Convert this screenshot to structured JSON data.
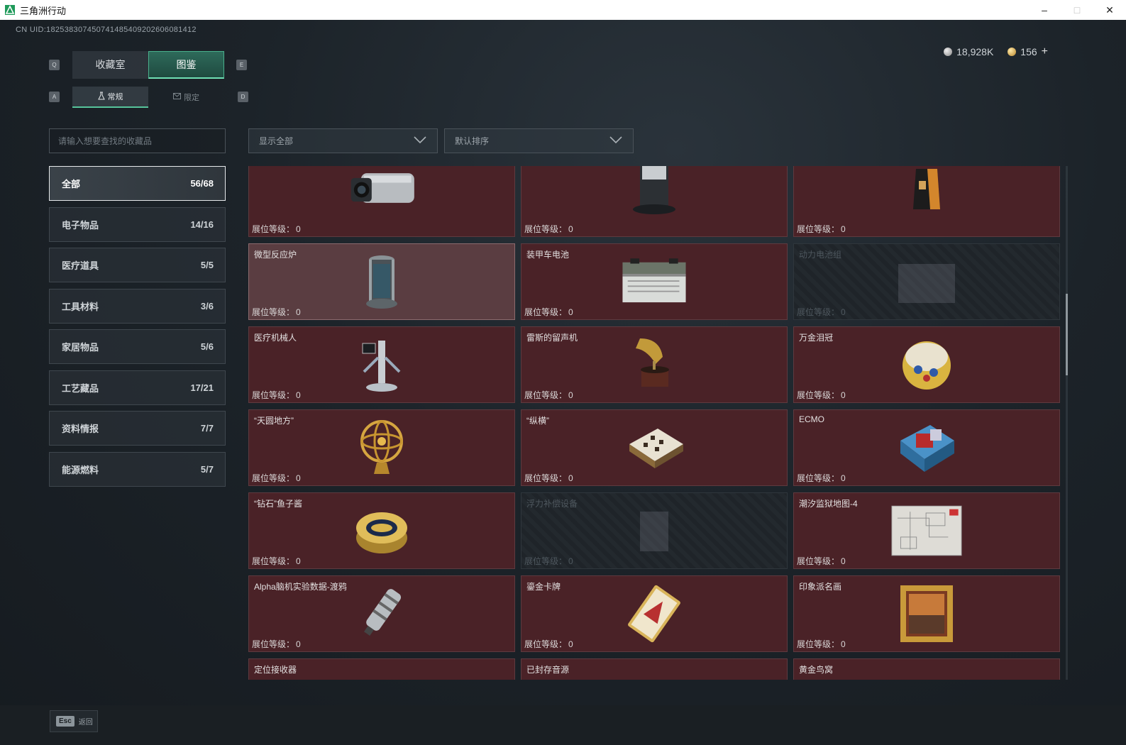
{
  "window": {
    "title": "三角洲行动"
  },
  "uid": "CN UID:18253830745074148540920260608141​2",
  "currency": {
    "silver": "18,928K",
    "gold": "156",
    "plus": "+"
  },
  "keys": {
    "q": "Q",
    "e": "E",
    "a": "A",
    "d": "D"
  },
  "tabs": [
    {
      "label": "收藏室"
    },
    {
      "label": "图鉴"
    }
  ],
  "subtabs": [
    {
      "label": "常规"
    },
    {
      "label": "限定"
    }
  ],
  "search": {
    "placeholder": "请输入想要查找的收藏品",
    "value": ""
  },
  "filters": {
    "display": "显示全部",
    "sort": "默认排序"
  },
  "categories": [
    {
      "label": "全部",
      "count": "56/68"
    },
    {
      "label": "电子物品",
      "count": "14/16"
    },
    {
      "label": "医疗道具",
      "count": "5/5"
    },
    {
      "label": "工具材料",
      "count": "3/6"
    },
    {
      "label": "家居物品",
      "count": "5/6"
    },
    {
      "label": "工艺藏品",
      "count": "17/21"
    },
    {
      "label": "资料情报",
      "count": "7/7"
    },
    {
      "label": "能源燃料",
      "count": "5/7"
    }
  ],
  "level_label": "展位等级：",
  "items": [
    {
      "name": "",
      "level": "0",
      "icon": "camera-icon"
    },
    {
      "name": "",
      "level": "0",
      "icon": "robot-vacuum-icon"
    },
    {
      "name": "",
      "level": "0",
      "icon": "coffee-bag-icon"
    },
    {
      "name": "微型反应炉",
      "level": "0",
      "icon": "reactor-icon"
    },
    {
      "name": "装甲车电池",
      "level": "0",
      "icon": "battery-icon"
    },
    {
      "name": "动力电池组",
      "level": "0",
      "icon": "battery-pack-icon"
    },
    {
      "name": "医疗机械人",
      "level": "0",
      "icon": "medical-robot-icon"
    },
    {
      "name": "雷斯的留声机",
      "level": "0",
      "icon": "gramophone-icon"
    },
    {
      "name": "万金泪冠",
      "level": "0",
      "icon": "jeweled-egg-icon"
    },
    {
      "name": "“天圆地方”",
      "level": "0",
      "icon": "armillary-sphere-icon"
    },
    {
      "name": "“纵横”",
      "level": "0",
      "icon": "chessboard-icon"
    },
    {
      "name": "ECMO",
      "level": "0",
      "icon": "ecmo-machine-icon"
    },
    {
      "name": "“钻石”鱼子酱",
      "level": "0",
      "icon": "caviar-tin-icon"
    },
    {
      "name": "浮力补偿设备",
      "level": "0",
      "icon": "buoyancy-device-icon"
    },
    {
      "name": "潮汐监狱地图-4",
      "level": "0",
      "icon": "map-icon"
    },
    {
      "name": "Alpha脑机实验数据-渡鸦",
      "level": "0",
      "icon": "data-drive-icon"
    },
    {
      "name": "鎏金卡牌",
      "level": "0",
      "icon": "gold-card-icon"
    },
    {
      "name": "印象派名画",
      "level": "0",
      "icon": "painting-icon"
    },
    {
      "name": "定位接收器",
      "level": "",
      "icon": "receiver-icon"
    },
    {
      "name": "已封存音源",
      "level": "",
      "icon": "reel-tape-icon"
    },
    {
      "name": "黄金鸟窝",
      "level": "",
      "icon": "golden-nest-icon"
    }
  ],
  "esc": {
    "key": "Esc",
    "label": "返回"
  },
  "colors": {
    "accent": "#49b08c",
    "card_bg": "#4a2227",
    "locked_bg": "#1f2429"
  }
}
